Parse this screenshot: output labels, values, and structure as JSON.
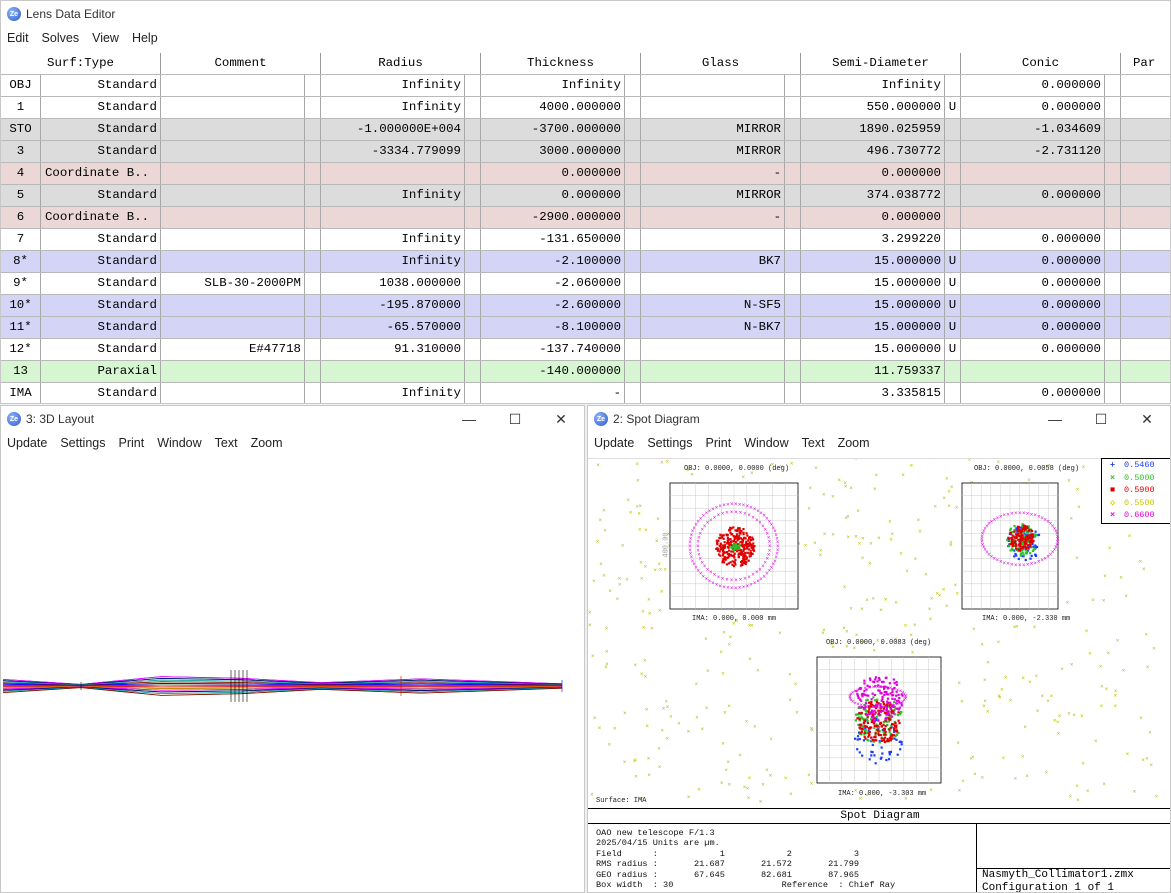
{
  "lde": {
    "title": "Lens Data Editor",
    "menus": [
      "Edit",
      "Solves",
      "View",
      "Help"
    ],
    "headers": [
      "Surf:Type",
      "Comment",
      "Radius",
      "Thickness",
      "Glass",
      "Semi-Diameter",
      "Conic",
      "Par"
    ],
    "rows": [
      {
        "num": "OBJ",
        "type": "Standard",
        "comment": "",
        "radius": "Infinity",
        "thickness": "Infinity",
        "glass": "",
        "semi": "Infinity",
        "semi_flag": "",
        "conic": "0.000000",
        "color": "white"
      },
      {
        "num": "1",
        "type": "Standard",
        "comment": "",
        "radius": "Infinity",
        "thickness": "4000.000000",
        "glass": "",
        "semi": "550.000000",
        "semi_flag": "U",
        "conic": "0.000000",
        "color": "white"
      },
      {
        "num": "STO",
        "type": "Standard",
        "comment": "",
        "radius": "-1.000000E+004",
        "thickness": "-3700.000000",
        "glass": "MIRROR",
        "semi": "1890.025959",
        "semi_flag": "",
        "conic": "-1.034609",
        "color": "gray"
      },
      {
        "num": "3",
        "type": "Standard",
        "comment": "",
        "radius": "-3334.779099",
        "thickness": "3000.000000",
        "glass": "MIRROR",
        "semi": "496.730772",
        "semi_flag": "",
        "conic": "-2.731120",
        "color": "gray"
      },
      {
        "num": "4",
        "type": "Coordinate B..",
        "comment": "",
        "radius": "",
        "thickness": "0.000000",
        "glass": "-",
        "semi": "0.000000",
        "semi_flag": "",
        "conic": "",
        "color": "pink"
      },
      {
        "num": "5",
        "type": "Standard",
        "comment": "",
        "radius": "Infinity",
        "thickness": "0.000000",
        "glass": "MIRROR",
        "semi": "374.038772",
        "semi_flag": "",
        "conic": "0.000000",
        "color": "gray"
      },
      {
        "num": "6",
        "type": "Coordinate B..",
        "comment": "",
        "radius": "",
        "thickness": "-2900.000000",
        "glass": "-",
        "semi": "0.000000",
        "semi_flag": "",
        "conic": "",
        "color": "pink"
      },
      {
        "num": "7",
        "type": "Standard",
        "comment": "",
        "radius": "Infinity",
        "thickness": "-131.650000",
        "glass": "",
        "semi": "3.299220",
        "semi_flag": "",
        "conic": "0.000000",
        "color": "white"
      },
      {
        "num": "8*",
        "type": "Standard",
        "comment": "",
        "radius": "Infinity",
        "thickness": "-2.100000",
        "glass": "BK7",
        "semi": "15.000000",
        "semi_flag": "U",
        "conic": "0.000000",
        "color": "blue"
      },
      {
        "num": "9*",
        "type": "Standard",
        "comment": "SLB-30-2000PM",
        "radius": "1038.000000",
        "thickness": "-2.060000",
        "glass": "",
        "semi": "15.000000",
        "semi_flag": "U",
        "conic": "0.000000",
        "color": "white"
      },
      {
        "num": "10*",
        "type": "Standard",
        "comment": "",
        "radius": "-195.870000",
        "thickness": "-2.600000",
        "glass": "N-SF5",
        "semi": "15.000000",
        "semi_flag": "U",
        "conic": "0.000000",
        "color": "blue"
      },
      {
        "num": "11*",
        "type": "Standard",
        "comment": "",
        "radius": "-65.570000",
        "thickness": "-8.100000",
        "glass": "N-BK7",
        "semi": "15.000000",
        "semi_flag": "U",
        "conic": "0.000000",
        "color": "blue"
      },
      {
        "num": "12*",
        "type": "Standard",
        "comment": "E#47718",
        "radius": "91.310000",
        "thickness": "-137.740000",
        "glass": "",
        "semi": "15.000000",
        "semi_flag": "U",
        "conic": "0.000000",
        "color": "white"
      },
      {
        "num": "13",
        "type": "Paraxial",
        "comment": "",
        "radius": "",
        "thickness": "-140.000000",
        "glass": "",
        "semi": "11.759337",
        "semi_flag": "",
        "conic": "",
        "color": "green"
      },
      {
        "num": "IMA",
        "type": "Standard",
        "comment": "",
        "radius": "Infinity",
        "thickness": "-",
        "glass": "",
        "semi": "3.335815",
        "semi_flag": "",
        "conic": "0.000000",
        "color": "white"
      }
    ]
  },
  "layout": {
    "title": "3: 3D Layout",
    "menus": [
      "Update",
      "Settings",
      "Print",
      "Window",
      "Text",
      "Zoom"
    ]
  },
  "spot": {
    "title": "2: Spot Diagram",
    "menus": [
      "Update",
      "Settings",
      "Print",
      "Window",
      "Text",
      "Zoom"
    ],
    "caption": "Spot Diagram",
    "legend": [
      {
        "wl": "0.5460",
        "color": "#1a3cff"
      },
      {
        "wl": "0.5000",
        "color": "#2bbf2b"
      },
      {
        "wl": "0.5900",
        "color": "#e00000"
      },
      {
        "wl": "0.5500",
        "color": "#c8c800"
      },
      {
        "wl": "0.6600",
        "color": "#e000e0"
      }
    ],
    "boxes": [
      {
        "obj": "OBJ: 0.0000, 0.0000 (deg)",
        "ima": "IMA: 0.000, 0.000 mm"
      },
      {
        "obj": "OBJ: 0.0000, 0.0058 (deg)",
        "ima": "IMA: 0.000, -2.330 mm"
      },
      {
        "obj": "OBJ: 0.0000, 0.0083 (deg)",
        "ima": "IMA: 0.000, -3.303 mm"
      }
    ],
    "axis_label": "400.00",
    "surface": "Surface: IMA",
    "info": {
      "line1": "OAO new telescope F/1.3",
      "line2": "2025/04/15  Units are µm.",
      "field": "Field      :            1            2            3",
      "rms": "RMS radius :       21.687       21.572       21.799",
      "geo": "GEO radius :       67.645       82.681       87.965",
      "box": "Box width  : 30                     Reference  : Chief Ray"
    },
    "file": "Nasmyth_Collimator1.zmx",
    "config": "Configuration 1 of 1"
  }
}
